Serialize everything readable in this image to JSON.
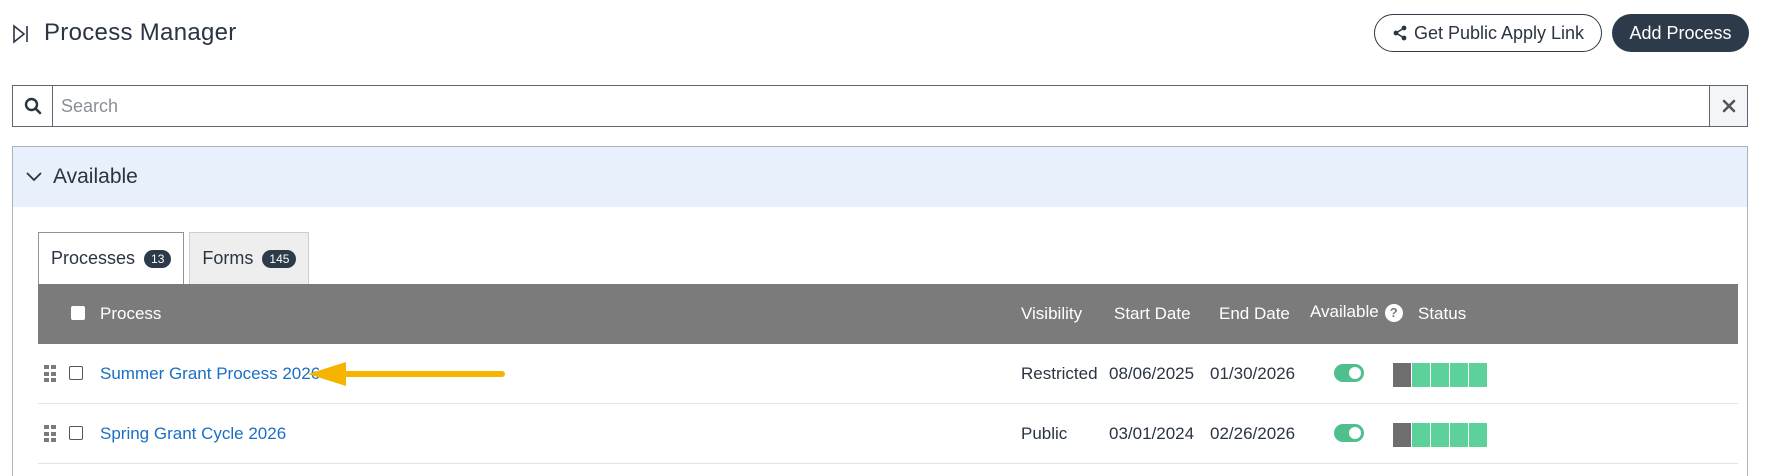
{
  "header": {
    "title": "Process Manager",
    "public_link_label": "Get Public Apply Link",
    "add_label": "Add Process"
  },
  "search": {
    "placeholder": "Search",
    "value": ""
  },
  "panel": {
    "title": "Available"
  },
  "tabs": [
    {
      "label": "Processes",
      "count": "13",
      "active": true
    },
    {
      "label": "Forms",
      "count": "145",
      "active": false
    }
  ],
  "table": {
    "columns": [
      "Process",
      "Visibility",
      "Start Date",
      "End Date",
      "Available",
      "Status"
    ],
    "rows": [
      {
        "process": "Summer Grant Process 2026",
        "visibility": "Restricted",
        "start": "08/06/2025",
        "end": "01/30/2026",
        "available": true
      },
      {
        "process": "Spring Grant Cycle 2026",
        "visibility": "Public",
        "start": "03/01/2024",
        "end": "02/26/2026",
        "available": true
      }
    ]
  },
  "colors": {
    "accent_dark": "#2d3a4a",
    "link": "#1a6fc4",
    "toggle_on": "#4fc08d",
    "status_dark": "#6e6e6e",
    "status_green": "#5cd199",
    "arrow": "#f4b400"
  },
  "status_segments": [
    "dark",
    "green",
    "green",
    "green",
    "green"
  ]
}
